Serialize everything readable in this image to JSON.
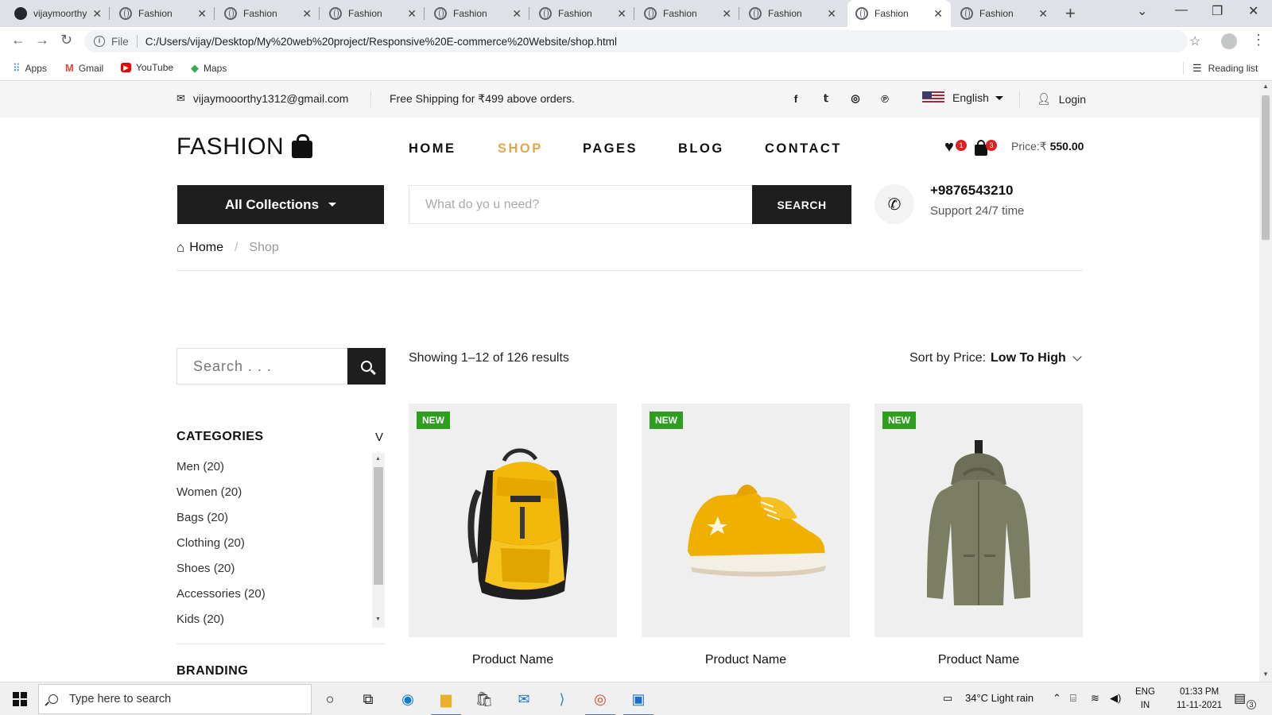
{
  "browser": {
    "tabs": [
      {
        "label": "vijaymoorthy",
        "icon": "github-icon"
      },
      {
        "label": "Fashion",
        "icon": "globe-icon"
      },
      {
        "label": "Fashion",
        "icon": "globe-icon"
      },
      {
        "label": "Fashion",
        "icon": "globe-icon"
      },
      {
        "label": "Fashion",
        "icon": "globe-icon"
      },
      {
        "label": "Fashion",
        "icon": "globe-icon"
      },
      {
        "label": "Fashion",
        "icon": "globe-icon"
      },
      {
        "label": "Fashion",
        "icon": "globe-icon"
      },
      {
        "label": "Fashion",
        "icon": "globe-icon",
        "active": true
      },
      {
        "label": "Fashion",
        "icon": "globe-icon"
      }
    ],
    "address": {
      "scheme_label": "File",
      "url": "C:/Users/vijay/Desktop/My%20web%20project/Responsive%20E-commerce%20Website/shop.html"
    },
    "bookmarks": [
      {
        "label": "Apps",
        "icon": "apps-grid-icon"
      },
      {
        "label": "Gmail",
        "icon": "gmail-icon"
      },
      {
        "label": "YouTube",
        "icon": "youtube-icon"
      },
      {
        "label": "Maps",
        "icon": "maps-icon"
      }
    ],
    "reading_list": "Reading list"
  },
  "topbar": {
    "email": "vijaymooorthy1312@gmail.com",
    "shipping": "Free Shipping for ₹499 above orders.",
    "social_icons": [
      "facebook-icon",
      "twitter-icon",
      "instagram-icon",
      "pinterest-icon"
    ],
    "language": "English",
    "login": "Login"
  },
  "header": {
    "logo": "FASHION",
    "nav": [
      {
        "label": "HOME",
        "active": false
      },
      {
        "label": "SHOP",
        "active": true
      },
      {
        "label": "PAGES",
        "active": false
      },
      {
        "label": "BLOG",
        "active": false
      },
      {
        "label": "CONTACT",
        "active": false
      }
    ],
    "wishlist_count": "1",
    "cart_count": "3",
    "price_label": "Price:₹",
    "price_value": "550.00",
    "accent_color": "#e0a84a"
  },
  "hero_bar": {
    "collections_label": "All Collections",
    "search_placeholder": "What do yo u need?",
    "search_button": "SEARCH",
    "phone": "+9876543210",
    "support": "Support 24/7 time"
  },
  "breadcrumb": {
    "home": "Home",
    "separator": "/",
    "current": "Shop"
  },
  "sidebar": {
    "search_placeholder": "Search . . .",
    "categories_title": "CATEGORIES",
    "categories_toggle": "V",
    "categories": [
      "Men (20)",
      "Women (20)",
      "Bags (20)",
      "Clothing (20)",
      "Shoes (20)",
      "Accessories (20)",
      "Kids (20)"
    ],
    "next_section_title": "BRANDING"
  },
  "shop": {
    "results_text": "Showing 1–12 of 126 results",
    "sort_label": "Sort by Price:",
    "sort_value": "Low To High",
    "products": [
      {
        "badge": "NEW",
        "name": "Product Name",
        "image": "backpack"
      },
      {
        "badge": "NEW",
        "name": "Product Name",
        "image": "sneaker"
      },
      {
        "badge": "NEW",
        "name": "Product Name",
        "image": "jacket"
      }
    ]
  },
  "taskbar": {
    "search_placeholder": "Type here to search",
    "weather": "34°C  Light rain",
    "lang_top": "ENG",
    "lang_bottom": "IN",
    "time": "01:33 PM",
    "date": "11-11-2021",
    "notifications": "3"
  }
}
